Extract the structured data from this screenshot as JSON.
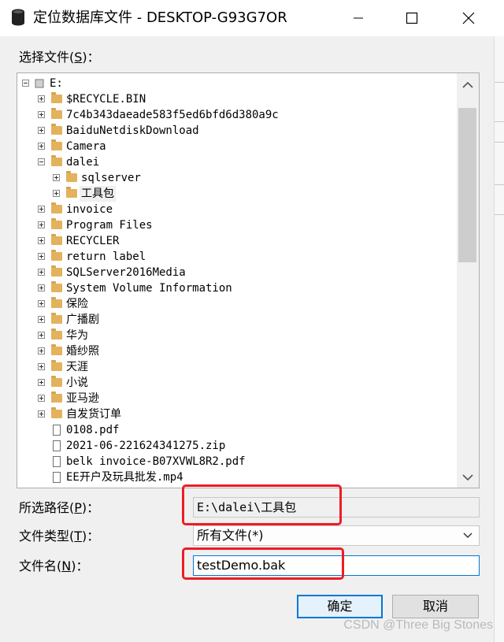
{
  "window": {
    "title": "定位数据库文件 - DESKTOP-G93G7OR",
    "icons": [
      "database-icon",
      "minimize-icon",
      "maximize-icon",
      "close-icon"
    ]
  },
  "select_label": {
    "text": "选择文件(",
    "key": "S",
    "end": ")："
  },
  "tree": {
    "root": "E:",
    "items": [
      {
        "name": "$RECYCLE.BIN"
      },
      {
        "name": "7c4b343daeade583f5ed6bfd6d380a9c"
      },
      {
        "name": "BaiduNetdiskDownload"
      },
      {
        "name": "Camera"
      },
      {
        "name": "dalei"
      },
      {
        "name": "sqlserver"
      },
      {
        "name": "工具包"
      },
      {
        "name": "invoice"
      },
      {
        "name": "Program Files"
      },
      {
        "name": "RECYCLER"
      },
      {
        "name": "return label"
      },
      {
        "name": "SQLServer2016Media"
      },
      {
        "name": "System Volume Information"
      },
      {
        "name": "保险"
      },
      {
        "name": "广播剧"
      },
      {
        "name": "华为"
      },
      {
        "name": "婚纱照"
      },
      {
        "name": "天涯"
      },
      {
        "name": "小说"
      },
      {
        "name": "亚马逊"
      },
      {
        "name": "自发货订单"
      },
      {
        "name": "0108.pdf"
      },
      {
        "name": "2021-06-221624341275.zip"
      },
      {
        "name": "belk invoice-B07XVWL8R2.pdf"
      },
      {
        "name": "EE开户及玩具批发.mp4"
      }
    ]
  },
  "path": {
    "label": "所选路径(",
    "key": "P",
    "end": ")：",
    "value": "E:\\dalei\\工具包"
  },
  "filetype": {
    "label": "文件类型(",
    "key": "T",
    "end": ")：",
    "value": "所有文件(*)"
  },
  "filename": {
    "label": "文件名(",
    "key": "N",
    "end": ")：",
    "value": "testDemo.bak"
  },
  "buttons": {
    "ok": "确定",
    "cancel": "取消"
  },
  "watermark": "CSDN @Three Big Stones",
  "colors": {
    "accent": "#0078d7",
    "highlight": "#ee1c25",
    "folder": "#e3b25c"
  }
}
